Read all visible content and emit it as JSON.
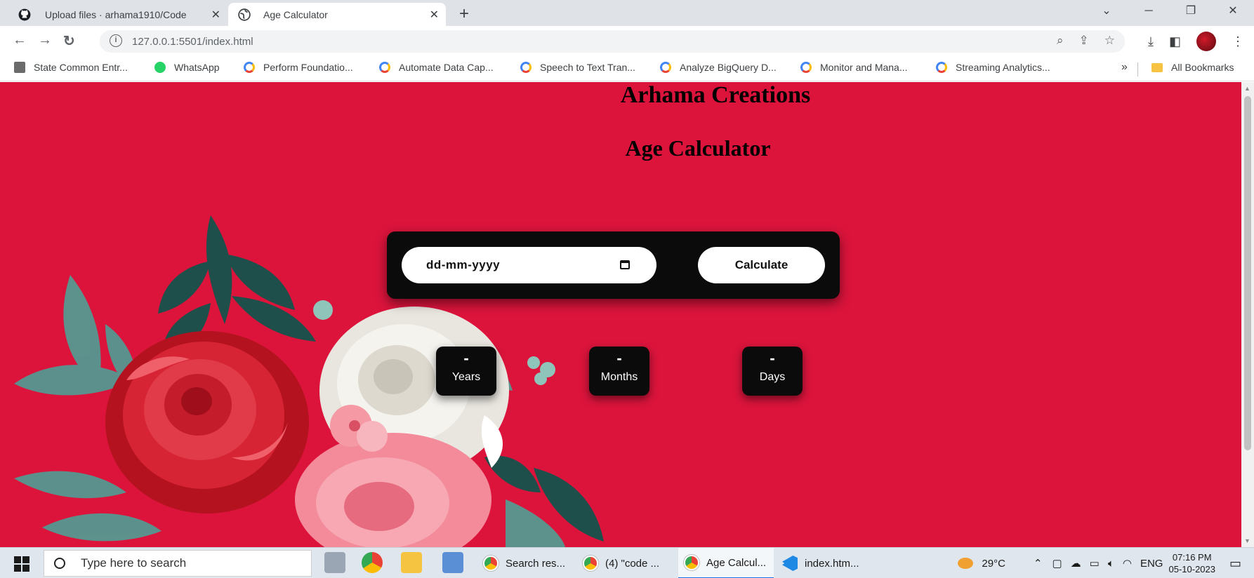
{
  "browser": {
    "tabs": [
      {
        "title": "Upload files · arhama1910/Code",
        "icon": "github-icon",
        "active": false
      },
      {
        "title": "Age Calculator",
        "icon": "globe-icon",
        "active": true
      }
    ],
    "url": "127.0.0.1:5501/index.html",
    "bookmarks": [
      {
        "label": "State Common Entr...",
        "icon": "emblem-icon"
      },
      {
        "label": "WhatsApp",
        "icon": "whatsapp-icon"
      },
      {
        "label": "Perform Foundatio...",
        "icon": "google-cloud-icon"
      },
      {
        "label": "Automate Data Cap...",
        "icon": "google-cloud-icon"
      },
      {
        "label": "Speech to Text Tran...",
        "icon": "google-cloud-icon"
      },
      {
        "label": "Analyze BigQuery D...",
        "icon": "google-cloud-icon"
      },
      {
        "label": "Monitor and Mana...",
        "icon": "google-cloud-icon"
      },
      {
        "label": "Streaming Analytics...",
        "icon": "google-cloud-icon"
      }
    ],
    "all_bookmarks": "All Bookmarks"
  },
  "page": {
    "brand": "Arhama Creations",
    "heading": "Age Calculator",
    "date_placeholder": "dd-mm-yyyy",
    "calculate_label": "Calculate",
    "results": [
      {
        "value": "-",
        "label": "Years"
      },
      {
        "value": "-",
        "label": "Months"
      },
      {
        "value": "-",
        "label": "Days"
      }
    ],
    "background_color": "#dc143c"
  },
  "taskbar": {
    "search_placeholder": "Type here to search",
    "tasks": [
      {
        "label": "Search res...",
        "active": false
      },
      {
        "label": "(4) \"code ...",
        "active": false
      },
      {
        "label": "Age Calcul...",
        "active": true
      },
      {
        "label": "index.htm...",
        "active": false
      }
    ],
    "weather": "29°C",
    "language": "ENG",
    "time": "07:16 PM",
    "date": "05-10-2023"
  }
}
